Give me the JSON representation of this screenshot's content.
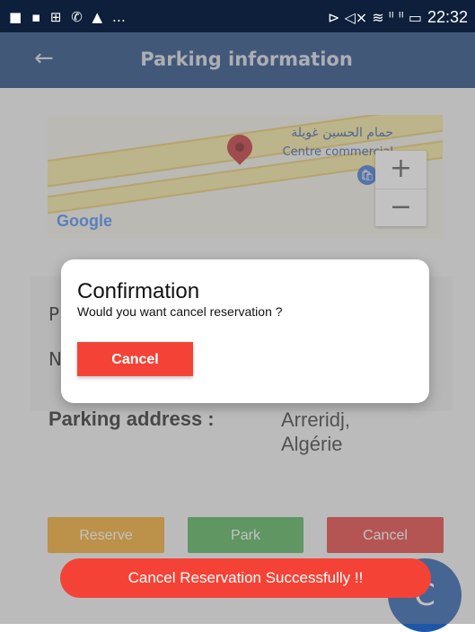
{
  "status_bar": {
    "left_icons": "■ ▪ ⊞ ✆ ▲ …",
    "right_icons": "⊳ ◁× ≋ ᴵᴵ ᴵᴵ ▭",
    "time": "22:32"
  },
  "app_bar": {
    "back_icon": "←",
    "title": "Parking information"
  },
  "map": {
    "label_arabic": "حمام الحسين غويلة",
    "label_french": "Centre commercial",
    "google_logo": "Google",
    "zoom_in": "+",
    "zoom_out": "−",
    "poi_icon": "🛍"
  },
  "details": {
    "row1_prefix": "P",
    "row2_prefix": "N",
    "address_label": "Parking address :",
    "address_value": "Arreridj,\nAlgérie"
  },
  "actions": {
    "reserve": "Reserve",
    "park": "Park",
    "cancel": "Cancel"
  },
  "fab_icon": "C",
  "dialog": {
    "title": "Confirmation",
    "message": "Would you want cancel reservation ?",
    "button": "Cancel"
  },
  "toast": "Cancel Reservation Successfully !!"
}
